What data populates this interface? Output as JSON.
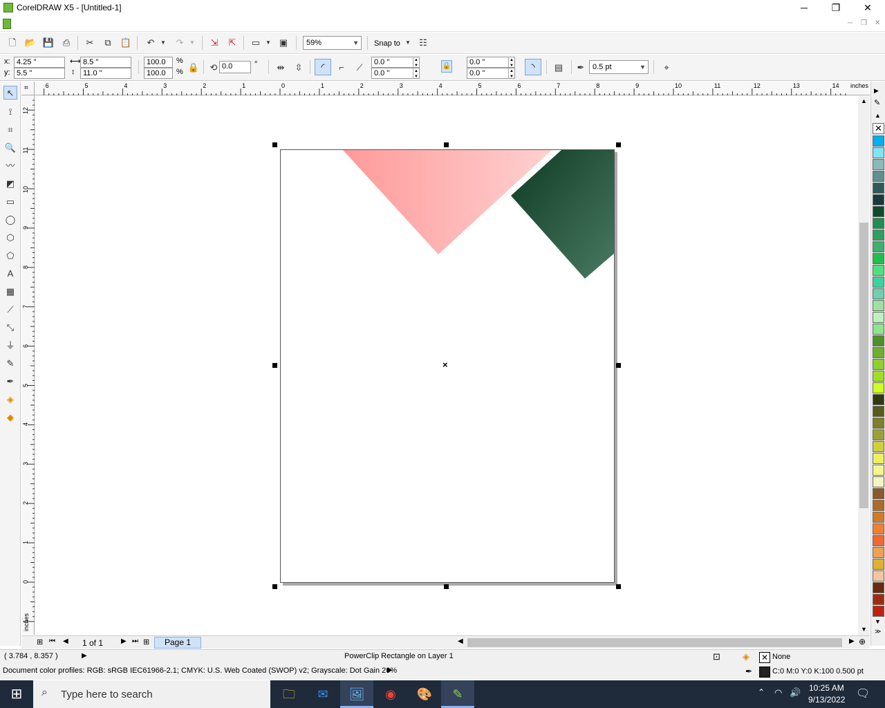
{
  "window": {
    "title": "CorelDRAW X5 - [Untitled-1]",
    "minimize": "─",
    "restore": "❐",
    "close": "✕"
  },
  "mdi": {
    "minimize": "─",
    "restore": "❐",
    "close": "✕"
  },
  "standard_toolbar": {
    "zoom": "59%",
    "snap_to": "Snap to"
  },
  "property_bar": {
    "x_label": "x:",
    "x_value": "4.25 \"",
    "y_label": "y:",
    "y_value": "5.5 \"",
    "width_value": "8.5 \"",
    "height_value": "11.0 \"",
    "scale_x": "100.0",
    "scale_y": "100.0",
    "percent": "%",
    "rotation": "0.0",
    "degree": "°",
    "corner_tl": "0.0 \"",
    "corner_bl": "0.0 \"",
    "corner_tr": "0.0 \"",
    "corner_br": "0.0 \"",
    "outline_width": "0.5 pt"
  },
  "ruler": {
    "units": "inches",
    "h_labels": [
      "6",
      "5",
      "4",
      "3",
      "2",
      "1",
      "0",
      "1",
      "2",
      "3",
      "4",
      "5",
      "6",
      "7",
      "8",
      "9",
      "10",
      "11",
      "12",
      "13",
      "14"
    ],
    "v_labels": [
      "12",
      "11",
      "10",
      "9",
      "8",
      "7",
      "6",
      "5",
      "4",
      "3",
      "2",
      "1",
      "0",
      "1"
    ]
  },
  "palette_colors": [
    "#00b0f0",
    "#7fe5f5",
    "#8cb8b8",
    "#5f8f8f",
    "#305a5a",
    "#1a3a3a",
    "#0f4a2a",
    "#1f8f4f",
    "#2f9f5f",
    "#3faf6f",
    "#1fbf4f",
    "#4fdf7f",
    "#3fd0a0",
    "#6fcfaf",
    "#9fdf9f",
    "#bfefbf",
    "#8fe58f",
    "#4f8f2f",
    "#6faf2f",
    "#8fcf2f",
    "#9fdf1f",
    "#cfff1f",
    "#303a10",
    "#5a5a1a",
    "#7f7f2a",
    "#9f9f3a",
    "#cfcf3a",
    "#efef5f",
    "#f5f590",
    "#f5f5c0",
    "#8a5a2a",
    "#b06a2a",
    "#d07a2a",
    "#f08030",
    "#f06a30",
    "#f0a050",
    "#e0b030",
    "#f5c59f",
    "#6a2a10",
    "#a02a10",
    "#c02010"
  ],
  "page_nav": {
    "position": "1 of 1",
    "page_tab": "Page 1"
  },
  "status": {
    "coords": "( 3.784 , 8.357 )",
    "object_info": "PowerClip Rectangle on Layer 1",
    "fill": "None",
    "color_profiles": "Document color profiles: RGB: sRGB IEC61966-2.1; CMYK: U.S. Web Coated (SWOP) v2; Grayscale: Dot Gain 20%",
    "outline": "C:0 M:0 Y:0 K:100  0.500 pt"
  },
  "taskbar": {
    "search_placeholder": "Type here to search",
    "time": "10:25 AM",
    "date": "9/13/2022"
  },
  "shapes": {
    "pink_fill_start": "#ff9a9a",
    "pink_fill_end": "#ffd0d0",
    "green_fill_start": "#0e3a22",
    "green_fill_end": "#4a7a62"
  }
}
